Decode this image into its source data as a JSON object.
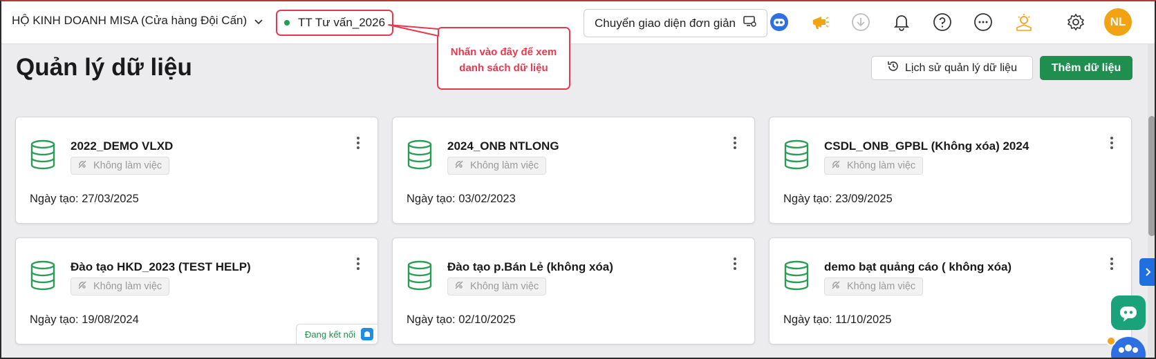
{
  "header": {
    "store_name": "HỘ KINH DOANH MISA (Cửa hàng Đội Cấn)",
    "current_db": "TT Tư vấn_2026",
    "callout_line1": "Nhấn vào đây để xem",
    "callout_line2": "danh sách dữ liệu",
    "switch_ui_label": "Chuyển giao diện đơn giản",
    "avatar_initials": "NL",
    "icons": [
      "robot-icon",
      "megaphone-icon",
      "download-icon",
      "bell-icon",
      "help-icon",
      "more-icon",
      "idea-icon",
      "gear-icon"
    ]
  },
  "page": {
    "title": "Quản lý dữ liệu",
    "history_label": "Lịch sử quản lý dữ liệu",
    "add_label": "Thêm dữ liệu"
  },
  "cards": [
    {
      "name": "2022_DEMO VLXD",
      "status": "Không làm việc",
      "date_label": "Ngày tạo: 27/03/2025"
    },
    {
      "name": "2024_ONB NTLONG",
      "status": "Không làm việc",
      "date_label": "Ngày tạo: 03/02/2023"
    },
    {
      "name": "CSDL_ONB_GPBL (Không xóa) 2024",
      "status": "Không làm việc",
      "date_label": "Ngày tạo: 23/09/2025"
    },
    {
      "name": "Đào tạo HKD_2023 (TEST HELP)",
      "status": "Không làm việc",
      "date_label": "Ngày tạo: 19/08/2024",
      "connection": "Đang kết nối"
    },
    {
      "name": "Đào tạo p.Bán Lẻ (không xóa)",
      "status": "Không làm việc",
      "date_label": "Ngày tạo: 02/10/2025"
    },
    {
      "name": "demo bạt quảng cáo ( không xóa)",
      "status": "Không làm việc",
      "date_label": "Ngày tạo: 11/10/2025"
    }
  ],
  "colors": {
    "accent_green": "#1e8f4f",
    "highlight_red": "#e53950",
    "avatar_orange": "#f2a313"
  }
}
